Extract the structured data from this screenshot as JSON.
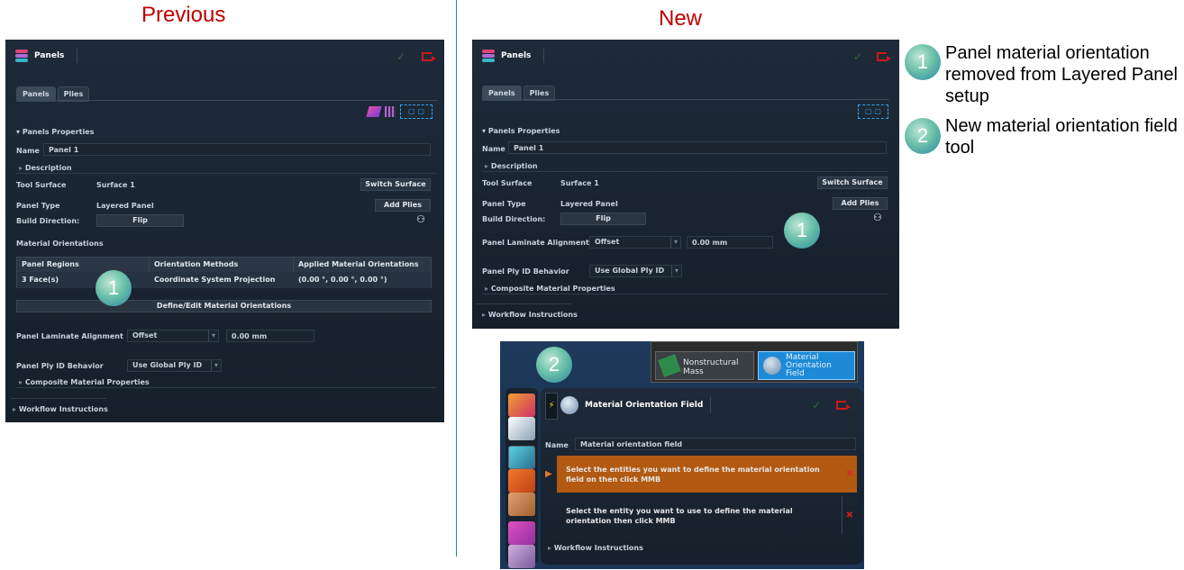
{
  "headings": {
    "previous": "Previous",
    "new": "New"
  },
  "legend": [
    {
      "number": "1",
      "text": "Panel material orientation removed from Layered Panel setup"
    },
    {
      "number": "2",
      "text": "New material orientation field tool"
    }
  ],
  "previous": {
    "title": "Panels",
    "tabs": [
      "Panels",
      "Plies"
    ],
    "section_properties": "Panels Properties",
    "name_label": "Name",
    "name_value": "Panel 1",
    "description": "Description",
    "tool_surface_label": "Tool Surface",
    "tool_surface_value": "Surface 1",
    "switch_surface": "Switch Surface",
    "panel_type_label": "Panel Type",
    "panel_type_value": "Layered Panel",
    "add_plies": "Add Plies",
    "build_direction_label": "Build Direction:",
    "flip": "Flip",
    "material_orientations": "Material Orientations",
    "table_headers": [
      "Panel Regions",
      "Orientation Methods",
      "Applied Material Orientations"
    ],
    "table_row": [
      "3 Face(s)",
      "Coordinate System Projection",
      "(0.00 °, 0.00 °, 0.00 °)"
    ],
    "define_edit": "Define/Edit Material Orientations",
    "laminate_label": "Panel Laminate Alignment",
    "laminate_value": "Offset",
    "offset_value": "0.00 mm",
    "ply_id_label": "Panel Ply ID Behavior",
    "ply_id_value": "Use Global Ply ID",
    "composite": "Composite Material Properties",
    "workflow": "Workflow Instructions",
    "badge": "1"
  },
  "newpanel": {
    "title": "Panels",
    "tabs": [
      "Panels",
      "Plies"
    ],
    "section_properties": "Panels Properties",
    "name_label": "Name",
    "name_value": "Panel 1",
    "description": "Description",
    "tool_surface_label": "Tool Surface",
    "tool_surface_value": "Surface 1",
    "switch_surface": "Switch Surface",
    "panel_type_label": "Panel Type",
    "panel_type_value": "Layered Panel",
    "add_plies": "Add Plies",
    "build_direction_label": "Build Direction:",
    "flip": "Flip",
    "laminate_label": "Panel Laminate Alignment",
    "laminate_value": "Offset",
    "offset_value": "0.00 mm",
    "ply_id_label": "Panel Ply ID Behavior",
    "ply_id_value": "Use Global Ply ID",
    "composite": "Composite Material Properties",
    "workflow": "Workflow Instructions",
    "badge": "1"
  },
  "tool": {
    "badge": "2",
    "ribbon_nonstructural": "Nonstructural Mass",
    "ribbon_material_orientation": "Material Orientation Field",
    "title": "Material Orientation Field",
    "name_label": "Name",
    "name_value": "Material orientation field",
    "step1": "Select the entities you want to define the material orientation field on then click MMB",
    "step2": "Select the entity you want to use to define the material orientation then click MMB",
    "workflow": "Workflow Instructions"
  }
}
